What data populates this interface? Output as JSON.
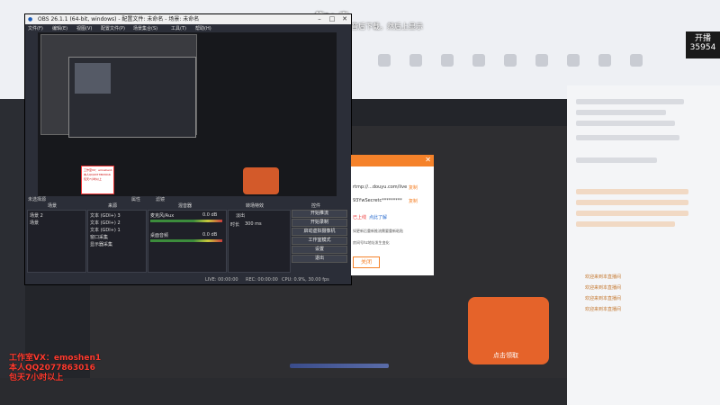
{
  "overlay": {
    "title": "第1：直",
    "tip": "贴耙开通抖音后下载。然后上显示"
  },
  "avatar_badge": {
    "line1": "开播",
    "line2": "35954"
  },
  "obs": {
    "title": "OBS 26.1.1 (64-bit, windows) - 配置文件: 未命名 - 场景: 未命名",
    "menu": [
      "文件(F)",
      "编辑(E)",
      "视图(V)",
      "配置文件(P)",
      "场景集合(S)",
      "工具(T)",
      "帮助(H)"
    ],
    "scene_label": "未选择源",
    "props_label": "属性",
    "filter_label": "滤镜",
    "docks": {
      "scenes": "场景",
      "sources": "来源",
      "mixer": "混音器",
      "transitions": "转场特效",
      "controls": "控件"
    },
    "scenes": [
      "场景 2",
      "场景"
    ],
    "sources": [
      "文本 (GDI+) 3",
      "文本 (GDI+) 2",
      "文本 (GDI+) 1",
      "窗口采集",
      "显示器采集"
    ],
    "mixer": [
      {
        "name": "麦克风/Aux",
        "db": "0.0 dB"
      },
      {
        "name": "桌面音频",
        "db": "0.0 dB"
      }
    ],
    "transition": {
      "type": "淡出",
      "duration_label": "时长",
      "duration": "300 ms"
    },
    "controls": [
      "开始推流",
      "开始录制",
      "启动虚拟摄像机",
      "工作室模式",
      "设置",
      "退出"
    ],
    "status": {
      "live": "LIVE: 00:00:00",
      "rec": "REC: 00:00:00",
      "cpu": "CPU: 0.9%, 30.00 fps"
    }
  },
  "preview_pink": [
    "工作室VX：emoshen1",
    "本人QQ2077863016",
    "包天7小时以上"
  ],
  "dialog": {
    "url": "rtmp://...douyu.com/live",
    "copy1": "复制",
    "secret": "93YwSecretc*********",
    "copy2": "复制",
    "note1": "已上线",
    "link": "点此了解",
    "note2": "如更新后重新推流需要重新粘贴",
    "note3": "房间号hz地址发生变化",
    "button": "关闭"
  },
  "watermark": {
    "line1": "工作室VX：emoshen1",
    "line2": "本人QQ2077863016",
    "line3": "包天7小时以上"
  },
  "promo": {
    "label": "点击领取"
  },
  "right_panel": {
    "items": [
      "欢迎来到本直播间",
      "欢迎来到本直播间",
      "欢迎来到本直播间",
      "欢迎来到本直播间"
    ]
  },
  "colors": {
    "accent": "#f5822a",
    "watermark": "#ff3b2f"
  }
}
